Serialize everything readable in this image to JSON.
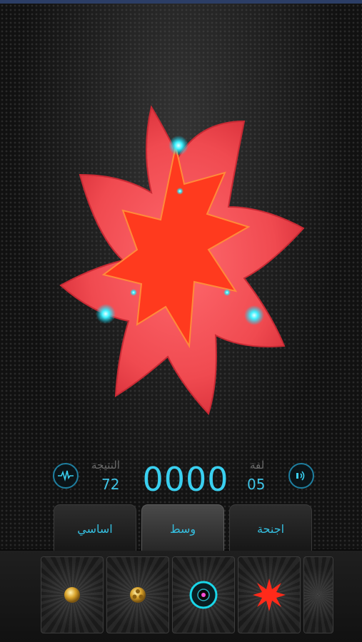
{
  "score_panel": {
    "result_label": "النتيجة",
    "result_value": "72",
    "score": "0000",
    "level_label": "لفة",
    "level_value": "05"
  },
  "tabs": [
    {
      "label": "اساسي",
      "active": false
    },
    {
      "label": "وسط",
      "active": true
    },
    {
      "label": "اجنحة",
      "active": false
    }
  ],
  "icons": {
    "left_button": "waveform-icon",
    "right_button": "sound-icon"
  },
  "pieces": [
    {
      "name": "gold-bead-piece"
    },
    {
      "name": "gold-flower-bead-piece"
    },
    {
      "name": "cyan-ring-piece"
    },
    {
      "name": "red-star-piece"
    },
    {
      "name": "partial-piece"
    }
  ],
  "colors": {
    "accent": "#3ad0f0",
    "star_outer": "#f04a50",
    "star_inner": "#ff3a1e"
  }
}
